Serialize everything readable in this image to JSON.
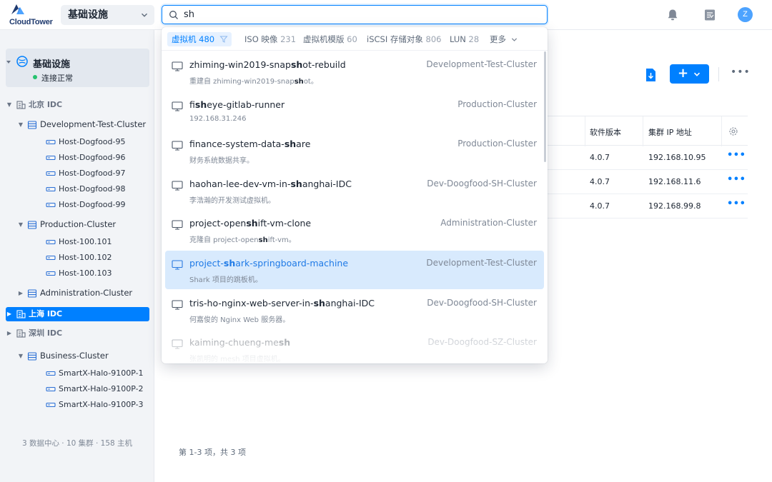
{
  "app": {
    "brand": "CloudTower",
    "context_selector": "基础设施",
    "avatar_letter": "Z",
    "colors": {
      "accent": "#0080ff",
      "selected_bg": "#d8eafd",
      "status_ok": "#25c26e"
    }
  },
  "search": {
    "query": "sh",
    "tabs": [
      {
        "label": "虚拟机",
        "count": "480",
        "active": true
      },
      {
        "label": "ISO 映像",
        "count": "231"
      },
      {
        "label": "虚拟机模版",
        "count": "60"
      },
      {
        "label": "iSCSI 存储对象",
        "count": "806"
      },
      {
        "label": "LUN",
        "count": "28"
      },
      {
        "label": "更多"
      }
    ],
    "results": [
      {
        "pre": "zhiming-win2019-snap",
        "hit": "sh",
        "post": "ot-rebuild",
        "sub_pre": "重建自 zhiming-win2019-snap",
        "sub_hit": "sh",
        "sub_post": "ot。",
        "cluster": "Development-Test-Cluster"
      },
      {
        "pre": "fi",
        "hit": "sh",
        "post": "eye-gitlab-runner",
        "sub_pre": "192.168.31.246",
        "sub_hit": "",
        "sub_post": "",
        "cluster": "Production-Cluster"
      },
      {
        "pre": "finance-system-data-",
        "hit": "sh",
        "post": "are",
        "sub_pre": "财务系统数据共享。",
        "sub_hit": "",
        "sub_post": "",
        "cluster": "Production-Cluster"
      },
      {
        "pre": "haohan-lee-dev-vm-in-",
        "hit": "sh",
        "post": "anghai-IDC",
        "sub_pre": "李浩瀚的开发测试虚拟机。",
        "sub_hit": "",
        "sub_post": "",
        "cluster": "Dev-Doogfood-SH-Cluster"
      },
      {
        "pre": "project-open",
        "hit": "sh",
        "post": "ift-vm-clone",
        "sub_pre": "克隆自 project-open",
        "sub_hit": "sh",
        "sub_post": "ift-vm。",
        "cluster": "Administration-Cluster"
      },
      {
        "pre": "project-",
        "hit": "sh",
        "post": "ark-springboard-machine",
        "sub_pre": "Shark 项目的跳板机。",
        "sub_hit": "",
        "sub_post": "",
        "cluster": "Development-Test-Cluster"
      },
      {
        "pre": "tris-ho-nginx-web-server-in-",
        "hit": "sh",
        "post": "anghai-IDC",
        "sub_pre": "何嘉俊的 Nginx Web 服务器。",
        "sub_hit": "",
        "sub_post": "",
        "cluster": "Dev-Doogfood-SH-Cluster"
      },
      {
        "pre": "kaiming-chueng-me",
        "hit": "sh",
        "post": "",
        "sub_pre": "张凯明的 mesh 项目虚拟机。",
        "sub_hit": "",
        "sub_post": "",
        "cluster": "Dev-Doogfood-SZ-Cluster"
      }
    ]
  },
  "sidebar": {
    "root": {
      "name": "基础设施",
      "status": "连接正常"
    },
    "tree": [
      {
        "label": "北京 IDC",
        "kind": "dc",
        "expanded": true
      },
      {
        "label": "Development-Test-Cluster",
        "kind": "cluster",
        "expanded": true
      },
      {
        "label": "Host-Dogfood-95",
        "kind": "host"
      },
      {
        "label": "Host-Dogfood-96",
        "kind": "host"
      },
      {
        "label": "Host-Dogfood-97",
        "kind": "host"
      },
      {
        "label": "Host-Dogfood-98",
        "kind": "host"
      },
      {
        "label": "Host-Dogfood-99",
        "kind": "host"
      },
      {
        "label": "Production-Cluster",
        "kind": "cluster",
        "expanded": true
      },
      {
        "label": "Host-100.101",
        "kind": "host"
      },
      {
        "label": "Host-100.102",
        "kind": "host"
      },
      {
        "label": "Host-100.103",
        "kind": "host"
      },
      {
        "label": "Administration-Cluster",
        "kind": "cluster",
        "expanded": false
      },
      {
        "label": "上海 IDC",
        "kind": "dc",
        "expanded": false,
        "selected": true
      },
      {
        "label": "深圳 IDC",
        "kind": "dc",
        "expanded": false
      },
      {
        "label": "Business-Cluster",
        "kind": "cluster",
        "expanded": true
      },
      {
        "label": "SmartX-Halo-9100P-1",
        "kind": "host"
      },
      {
        "label": "SmartX-Halo-9100P-2",
        "kind": "host"
      },
      {
        "label": "SmartX-Halo-9100P-3",
        "kind": "host"
      }
    ],
    "summary": "3 数据中心 · 10 集群 · 158 主机"
  },
  "table": {
    "columns": [
      "软件版本",
      "集群 IP 地址"
    ],
    "rows": [
      {
        "version": "4.0.7",
        "ip": "192.168.10.95"
      },
      {
        "version": "4.0.7",
        "ip": "192.168.11.6"
      },
      {
        "version": "4.0.7",
        "ip": "192.168.99.8"
      }
    ],
    "row_action": "•••",
    "pagination": "第 1-3 项，共 3 项"
  },
  "toolbar": {
    "add_label": "+",
    "more_label": "•••"
  }
}
